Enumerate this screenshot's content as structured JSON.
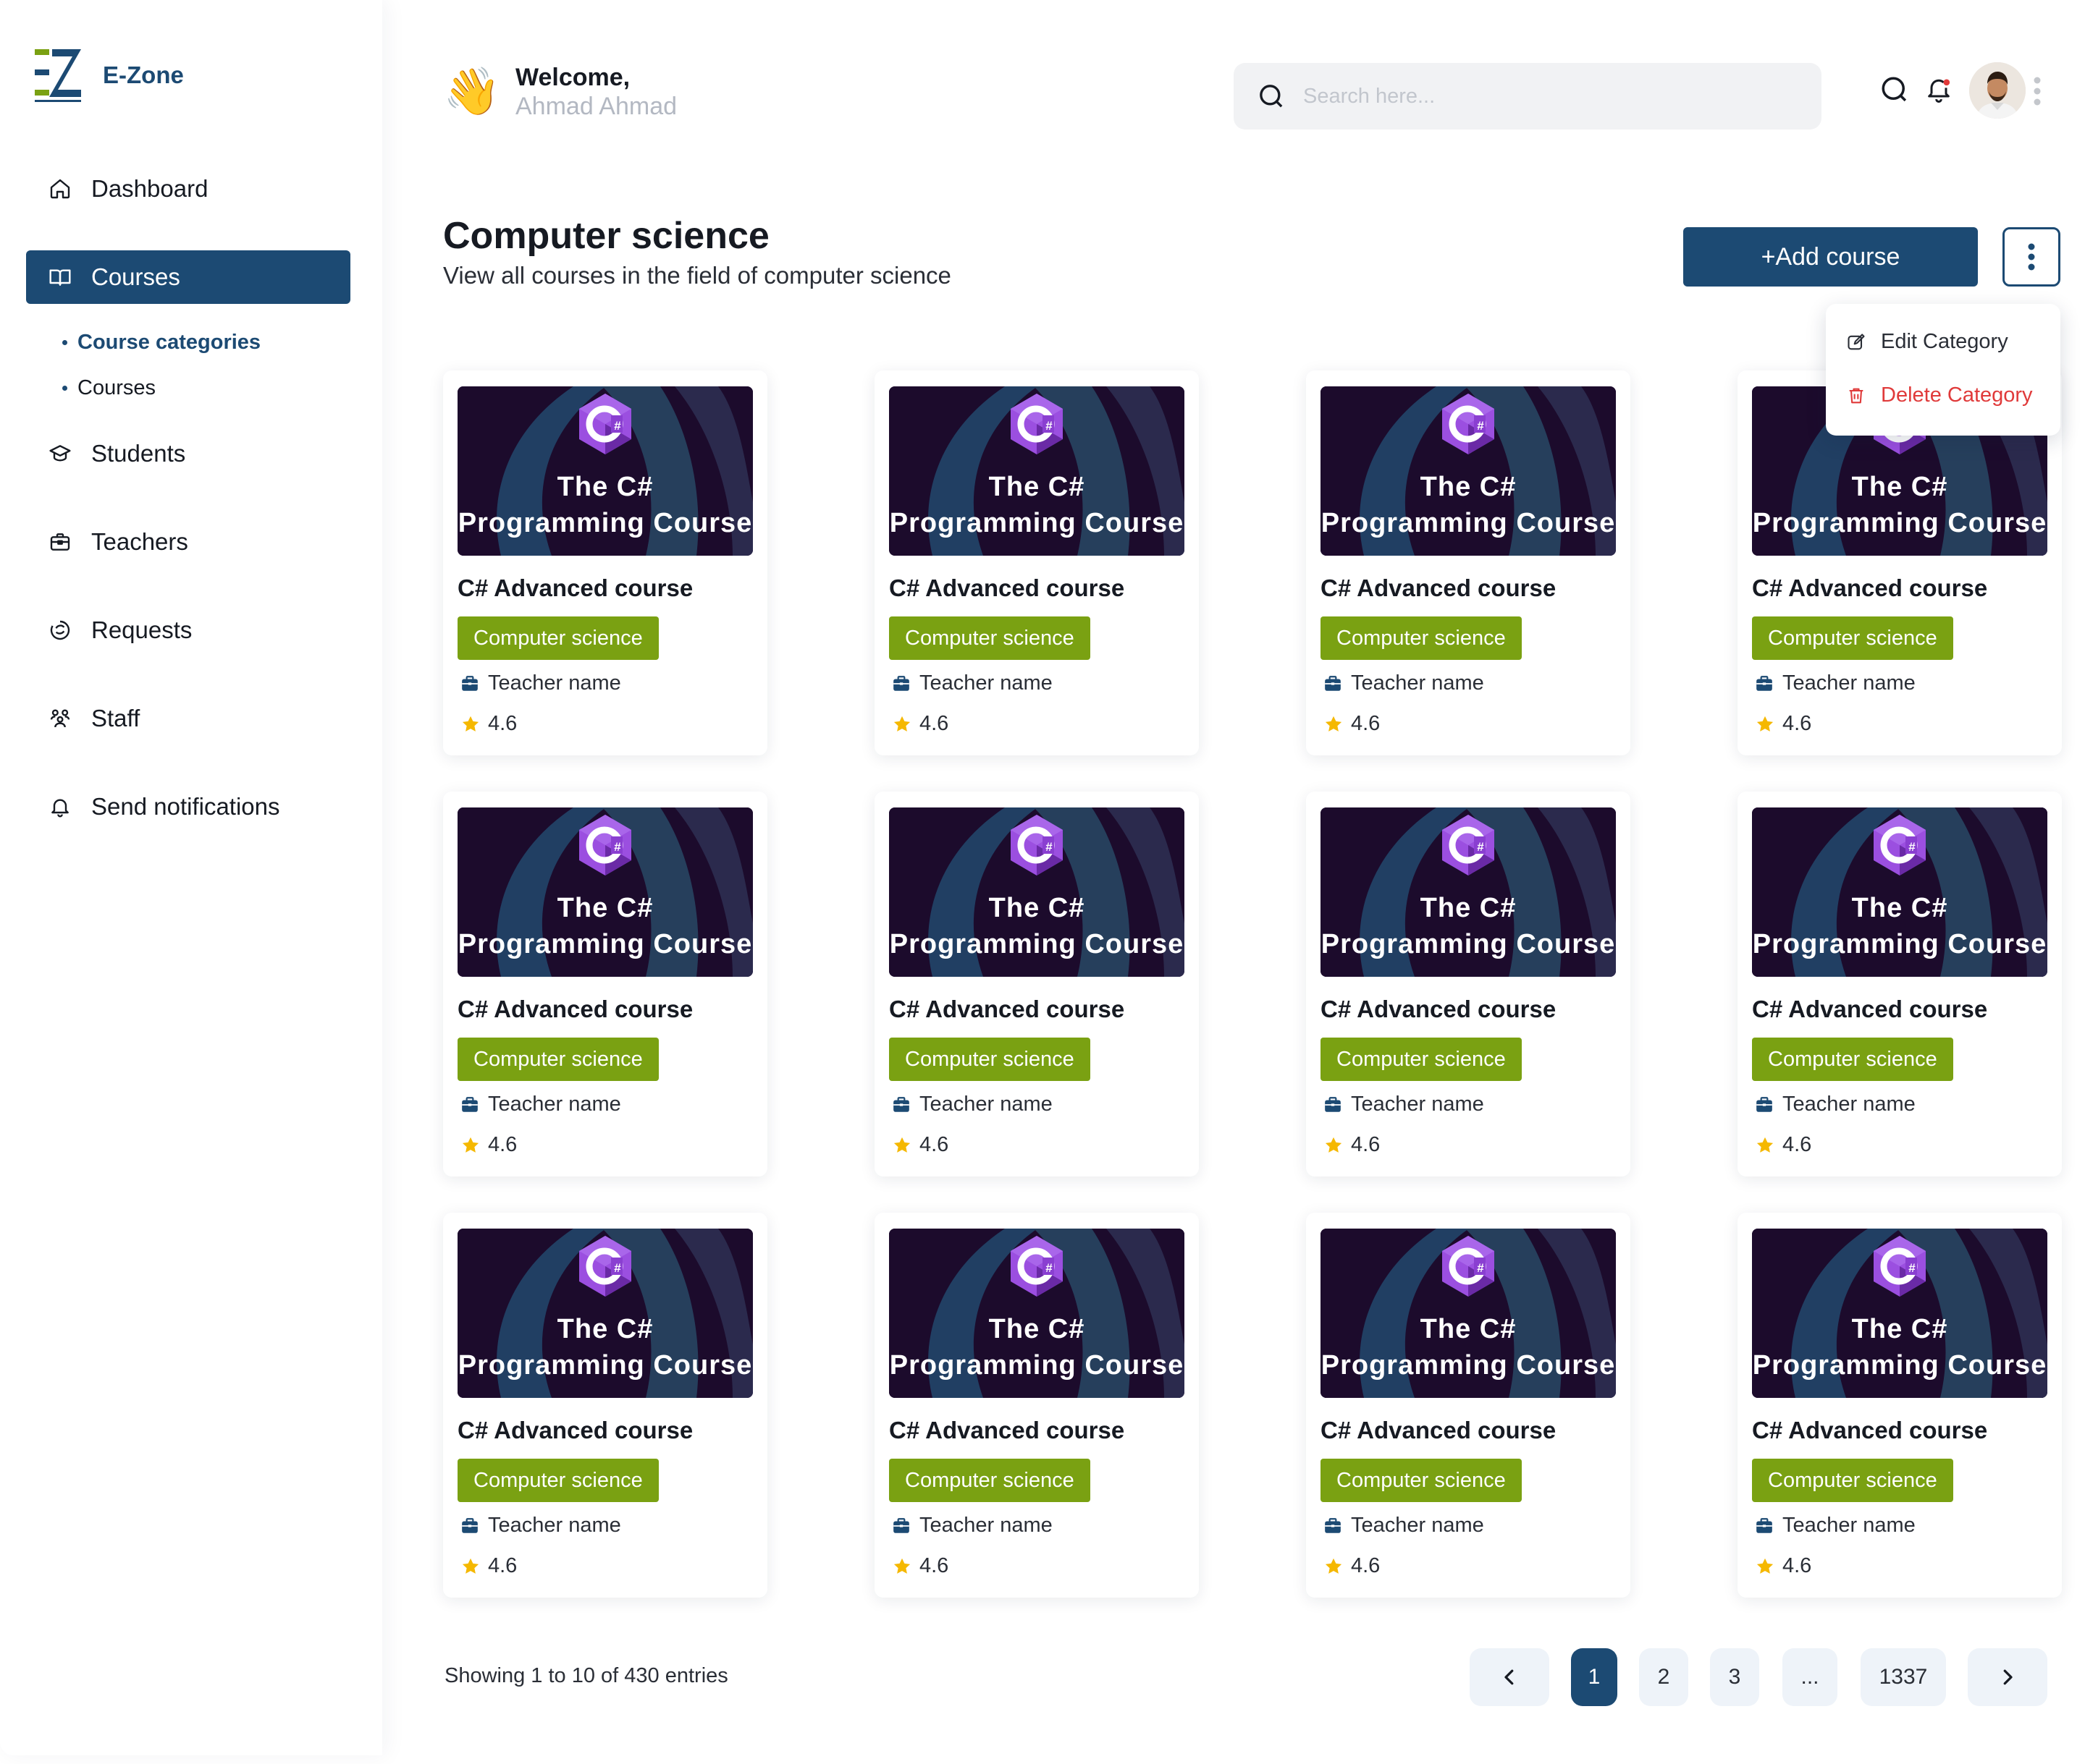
{
  "brand": {
    "name": "E-Zone",
    "logo_letters": "EZ"
  },
  "sidebar": {
    "items": [
      {
        "label": "Dashboard",
        "icon": "home-icon"
      },
      {
        "label": "Courses",
        "icon": "book-open-icon",
        "active": true
      },
      {
        "label": "Students",
        "icon": "graduation-cap-icon"
      },
      {
        "label": "Teachers",
        "icon": "briefcase-icon"
      },
      {
        "label": "Requests",
        "icon": "request-icon"
      },
      {
        "label": "Staff",
        "icon": "team-icon"
      },
      {
        "label": "Send notifications",
        "icon": "bell-icon"
      }
    ],
    "sub_items": [
      {
        "label": "Course categories",
        "active": true
      },
      {
        "label": "Courses"
      }
    ]
  },
  "header": {
    "welcome": "Welcome,",
    "user_name": "Ahmad Ahmad",
    "wave_emoji": "👋",
    "search_placeholder": "Search here..."
  },
  "page": {
    "title": "Computer science",
    "subtitle": "View all courses in the field of computer science",
    "add_button": "+Add course"
  },
  "menu": {
    "edit": "Edit Category",
    "delete": "Delete Category"
  },
  "courses": [
    {
      "thumb_line1": "The C#",
      "thumb_line2": "Programming Course",
      "title": "C# Advanced course",
      "category": "Computer science",
      "teacher": "Teacher name",
      "rating": "4.6"
    },
    {
      "thumb_line1": "The C#",
      "thumb_line2": "Programming Course",
      "title": "C# Advanced course",
      "category": "Computer science",
      "teacher": "Teacher name",
      "rating": "4.6"
    },
    {
      "thumb_line1": "The C#",
      "thumb_line2": "Programming Course",
      "title": "C# Advanced course",
      "category": "Computer science",
      "teacher": "Teacher name",
      "rating": "4.6"
    },
    {
      "thumb_line1": "The C#",
      "thumb_line2": "Programming Course",
      "title": "C# Advanced course",
      "category": "Computer science",
      "teacher": "Teacher name",
      "rating": "4.6"
    },
    {
      "thumb_line1": "The C#",
      "thumb_line2": "Programming Course",
      "title": "C# Advanced course",
      "category": "Computer science",
      "teacher": "Teacher name",
      "rating": "4.6"
    },
    {
      "thumb_line1": "The C#",
      "thumb_line2": "Programming Course",
      "title": "C# Advanced course",
      "category": "Computer science",
      "teacher": "Teacher name",
      "rating": "4.6"
    },
    {
      "thumb_line1": "The C#",
      "thumb_line2": "Programming Course",
      "title": "C# Advanced course",
      "category": "Computer science",
      "teacher": "Teacher name",
      "rating": "4.6"
    },
    {
      "thumb_line1": "The C#",
      "thumb_line2": "Programming Course",
      "title": "C# Advanced course",
      "category": "Computer science",
      "teacher": "Teacher name",
      "rating": "4.6"
    },
    {
      "thumb_line1": "The C#",
      "thumb_line2": "Programming Course",
      "title": "C# Advanced course",
      "category": "Computer science",
      "teacher": "Teacher name",
      "rating": "4.6"
    },
    {
      "thumb_line1": "The C#",
      "thumb_line2": "Programming Course",
      "title": "C# Advanced course",
      "category": "Computer science",
      "teacher": "Teacher name",
      "rating": "4.6"
    },
    {
      "thumb_line1": "The C#",
      "thumb_line2": "Programming Course",
      "title": "C# Advanced course",
      "category": "Computer science",
      "teacher": "Teacher name",
      "rating": "4.6"
    },
    {
      "thumb_line1": "The C#",
      "thumb_line2": "Programming Course",
      "title": "C# Advanced course",
      "category": "Computer science",
      "teacher": "Teacher name",
      "rating": "4.6"
    }
  ],
  "pagination": {
    "summary": "Showing 1 to 10 of 430 entries",
    "pages": [
      "1",
      "2",
      "3",
      "...",
      "1337"
    ],
    "current": "1"
  },
  "colors": {
    "primary": "#1c4a73",
    "category_tag": "#7aa112",
    "danger": "#e03a3a",
    "star": "#f5b800",
    "thumb_bg": "#1c0b2c",
    "csharp_purple": "#8a3fd1"
  }
}
